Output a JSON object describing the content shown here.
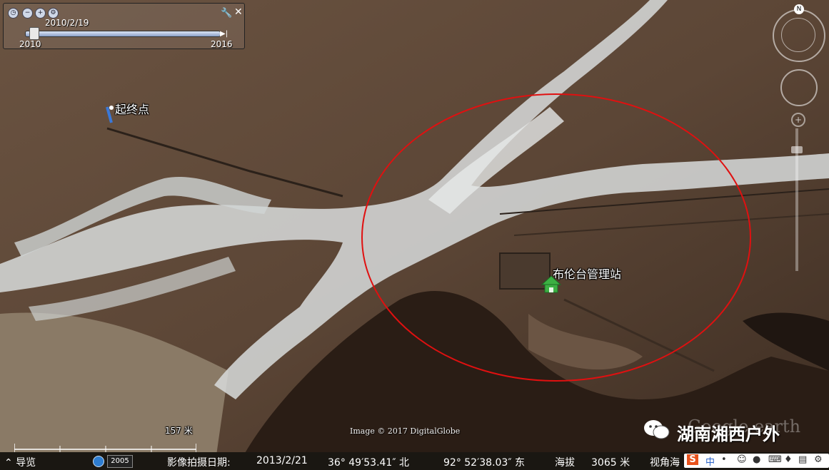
{
  "time_slider": {
    "current_date": "2010/2/19",
    "start_year": "2010",
    "end_year": "2016",
    "position": 0.03
  },
  "placemarks": {
    "start_end_point": "起终点",
    "station": "布伦台管理站"
  },
  "credit": "Image © 2017 DigitalGlobe",
  "scale_label": "157 米",
  "earth_brand": "Google earth",
  "watermark": "湖南湘西户外",
  "status": {
    "nav_label": "导览",
    "year_badge": "2005",
    "capture_date_label": "影像拍摄日期:",
    "capture_date": "2013/2/21",
    "latitude": "36° 49′53.41″ 北",
    "longitude": "92° 52′38.03″ 东",
    "elevation_label": "海拔",
    "elevation": "3065 米",
    "view_label": "视角海"
  },
  "ime": {
    "logo": "S",
    "mode": "中"
  },
  "colors": {
    "circle": "#e01010",
    "house_icon": "#3cb043",
    "terrain": "#5a4636",
    "riverbed": "#d8dcdc"
  }
}
